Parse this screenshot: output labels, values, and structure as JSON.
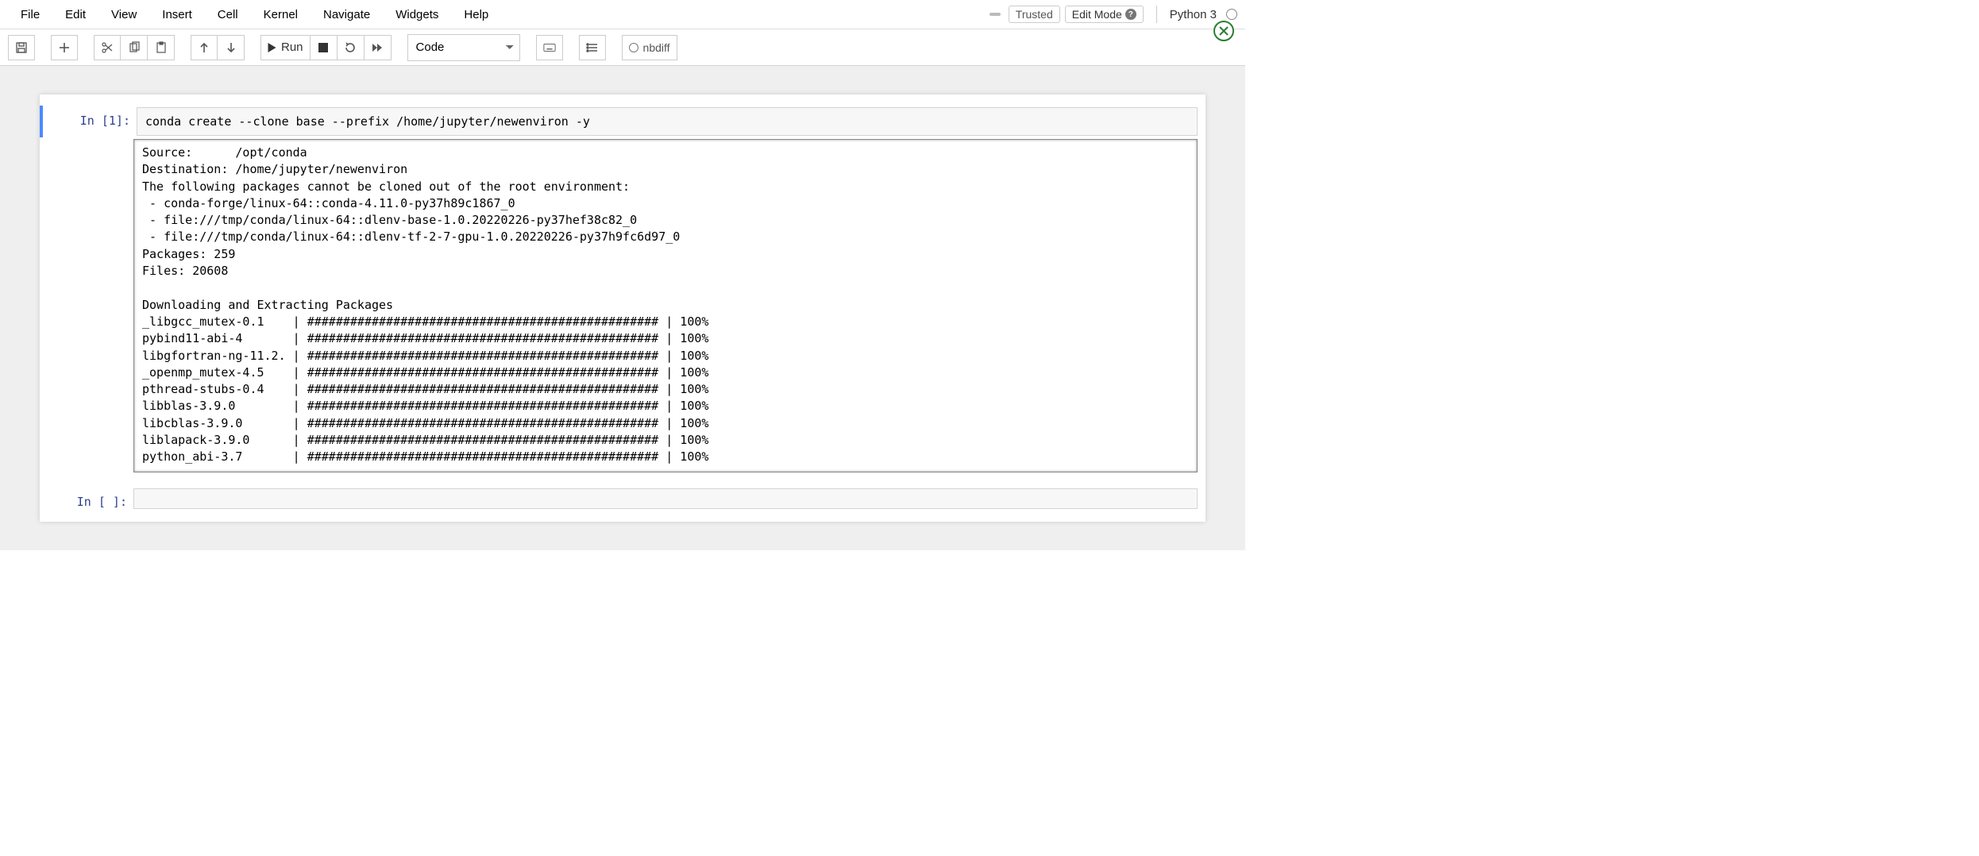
{
  "menu": {
    "file": "File",
    "edit": "Edit",
    "view": "View",
    "insert": "Insert",
    "cell": "Cell",
    "kernel": "Kernel",
    "navigate": "Navigate",
    "widgets": "Widgets",
    "help": "Help"
  },
  "header": {
    "trusted": "Trusted",
    "editmode": "Edit Mode",
    "kernel": "Python 3"
  },
  "toolbar": {
    "run": "Run",
    "celltype": "Code",
    "nbdiff": "nbdiff"
  },
  "cell1": {
    "prompt": "In [1]:",
    "code": "conda create --clone base --prefix /home/jupyter/newenviron -y",
    "output": "Source:      /opt/conda\nDestination: /home/jupyter/newenviron\nThe following packages cannot be cloned out of the root environment:\n - conda-forge/linux-64::conda-4.11.0-py37h89c1867_0\n - file:///tmp/conda/linux-64::dlenv-base-1.0.20220226-py37hef38c82_0\n - file:///tmp/conda/linux-64::dlenv-tf-2-7-gpu-1.0.20220226-py37h9fc6d97_0\nPackages: 259\nFiles: 20608\n\nDownloading and Extracting Packages\n_libgcc_mutex-0.1    | ################################################# | 100%\npybind11-abi-4       | ################################################# | 100%\nlibgfortran-ng-11.2. | ################################################# | 100%\n_openmp_mutex-4.5    | ################################################# | 100%\npthread-stubs-0.4    | ################################################# | 100%\nlibblas-3.9.0        | ################################################# | 100%\nlibcblas-3.9.0       | ################################################# | 100%\nliblapack-3.9.0      | ################################################# | 100%\npython_abi-3.7       | ################################################# | 100%"
  },
  "cell2": {
    "prompt": "In [ ]:",
    "code": ""
  }
}
